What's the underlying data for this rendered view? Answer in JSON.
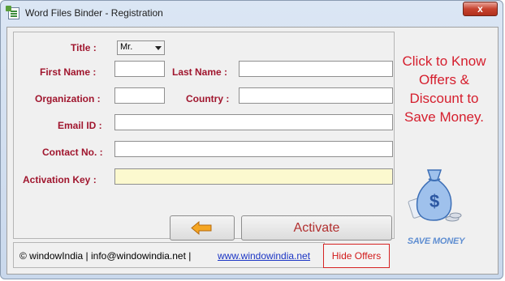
{
  "window": {
    "title": "Word Files Binder  - Registration",
    "close_label": "x"
  },
  "form": {
    "title_label": "Title :",
    "title_value": "Mr.",
    "first_name_label": "First Name :",
    "first_name_value": "",
    "last_name_label": "Last Name :",
    "last_name_value": "",
    "organization_label": "Organization :",
    "organization_value": "",
    "country_label": "Country :",
    "country_value": "",
    "email_label": "Email ID :",
    "email_value": "",
    "contact_label": "Contact No. :",
    "contact_value": "",
    "activation_label": "Activation Key :",
    "activation_value": "",
    "activate_button": "Activate"
  },
  "footer": {
    "info_text": "© windowIndia  |  info@windowindia.net  |",
    "website_link": "www.windowindia.net",
    "hide_offers_button": "Hide Offers"
  },
  "offers": {
    "line1": "Click to Know",
    "line2": "Offers &",
    "line3": "Discount to",
    "line4": "Save Money.",
    "badge_text": "SAVE MONEY"
  },
  "colors": {
    "label_red": "#a0162e",
    "offer_red": "#d51e2d",
    "link_blue": "#1a34c4",
    "activation_field_bg": "#fcf9cf"
  }
}
